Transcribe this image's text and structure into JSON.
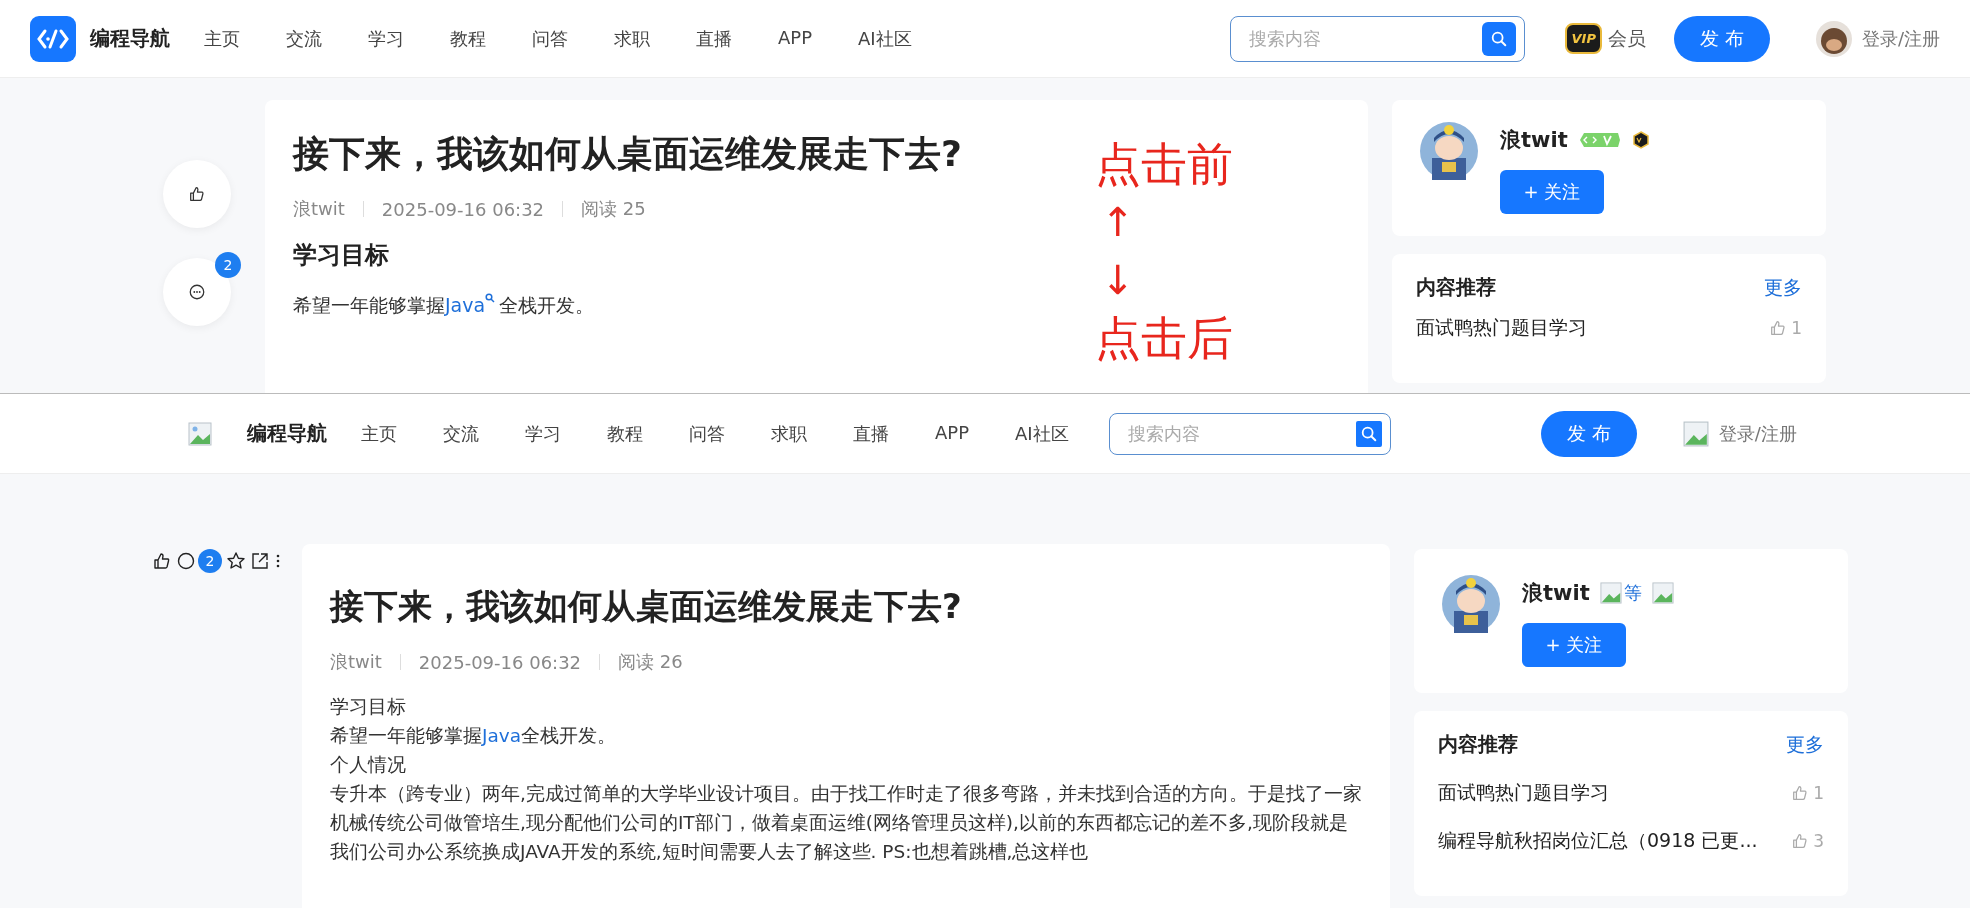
{
  "panels": [
    {
      "kind": "before",
      "header": {
        "logo_text": "编程导航",
        "nav": [
          "主页",
          "交流",
          "学习",
          "教程",
          "问答",
          "求职",
          "直播",
          "APP",
          "AI社区"
        ],
        "search": {
          "placeholder": "搜索内容"
        },
        "vip": {
          "badge": "VIP",
          "label": "会员"
        },
        "publish": "发 布",
        "login": "登录/注册"
      },
      "actions": {
        "comment_count": "2"
      },
      "article": {
        "title": "接下来，我该如何从桌面运维发展走下去?",
        "author": "浪twit",
        "date": "2025-09-16 06:32",
        "reads": "阅读 25",
        "body": [
          {
            "kind": "heading",
            "parts": [
              {
                "kind": "text",
                "text": "学习目标"
              }
            ]
          },
          {
            "kind": "paragraph",
            "parts": [
              {
                "kind": "text",
                "text": "希望一年能够掌握"
              },
              {
                "kind": "search-link",
                "text": "Java"
              },
              {
                "kind": "text",
                "text": "全栈开发。"
              }
            ]
          }
        ]
      },
      "author_card": {
        "name": "浪twit",
        "follow": "+ 关注"
      },
      "recommend": {
        "title": "内容推荐",
        "more": "更多",
        "items": [
          {
            "title": "面试鸭热门题目学习",
            "likes": "1"
          }
        ]
      },
      "annotation": {
        "before": "点击前",
        "up": "↑",
        "down": "↓",
        "after": "点击后"
      }
    },
    {
      "kind": "after",
      "header": {
        "logo_text": "编程导航",
        "nav": [
          "主页",
          "交流",
          "学习",
          "教程",
          "问答",
          "求职",
          "直播",
          "APP",
          "AI社区"
        ],
        "search": {
          "placeholder": "搜索内容"
        },
        "publish": "发 布",
        "login": "登录/注册"
      },
      "actions": {
        "comment_count": "2"
      },
      "article": {
        "title": "接下来，我该如何从桌面运维发展走下去?",
        "author": "浪twit",
        "date": "2025-09-16 06:32",
        "reads": "阅读 26",
        "body": [
          {
            "kind": "line",
            "parts": [
              {
                "kind": "text",
                "text": "学习目标"
              }
            ]
          },
          {
            "kind": "line",
            "parts": [
              {
                "kind": "text",
                "text": "希望一年能够掌握"
              },
              {
                "kind": "link",
                "text": "Java"
              },
              {
                "kind": "text",
                "text": "全栈开发。"
              }
            ]
          },
          {
            "kind": "line",
            "parts": [
              {
                "kind": "text",
                "text": "个人情况"
              }
            ]
          },
          {
            "kind": "line",
            "parts": [
              {
                "kind": "text",
                "text": "专升本（跨专业）两年,完成过简单的大学毕业设计项目。由于找工作时走了很多弯路，并未找到合适的方向。于是找了一家机械传统公司做管培生,现分配他们公司的IT部门，做着桌面运维(网络管理员这样),以前的东西都忘记的差不多,现阶段就是我们公司办公系统换成JAVA开发的系统,短时间需要人去了解这些. PS:也想着跳槽,总这样也"
              }
            ]
          }
        ]
      },
      "author_card": {
        "name": "浪twit",
        "badge_alt": "等",
        "follow": "+ 关注"
      },
      "recommend": {
        "title": "内容推荐",
        "more": "更多",
        "items": [
          {
            "title": "面试鸭热门题目学习",
            "likes": "1"
          },
          {
            "title": "编程导航秋招岗位汇总（0918 已更...",
            "likes": "3"
          }
        ]
      }
    }
  ]
}
